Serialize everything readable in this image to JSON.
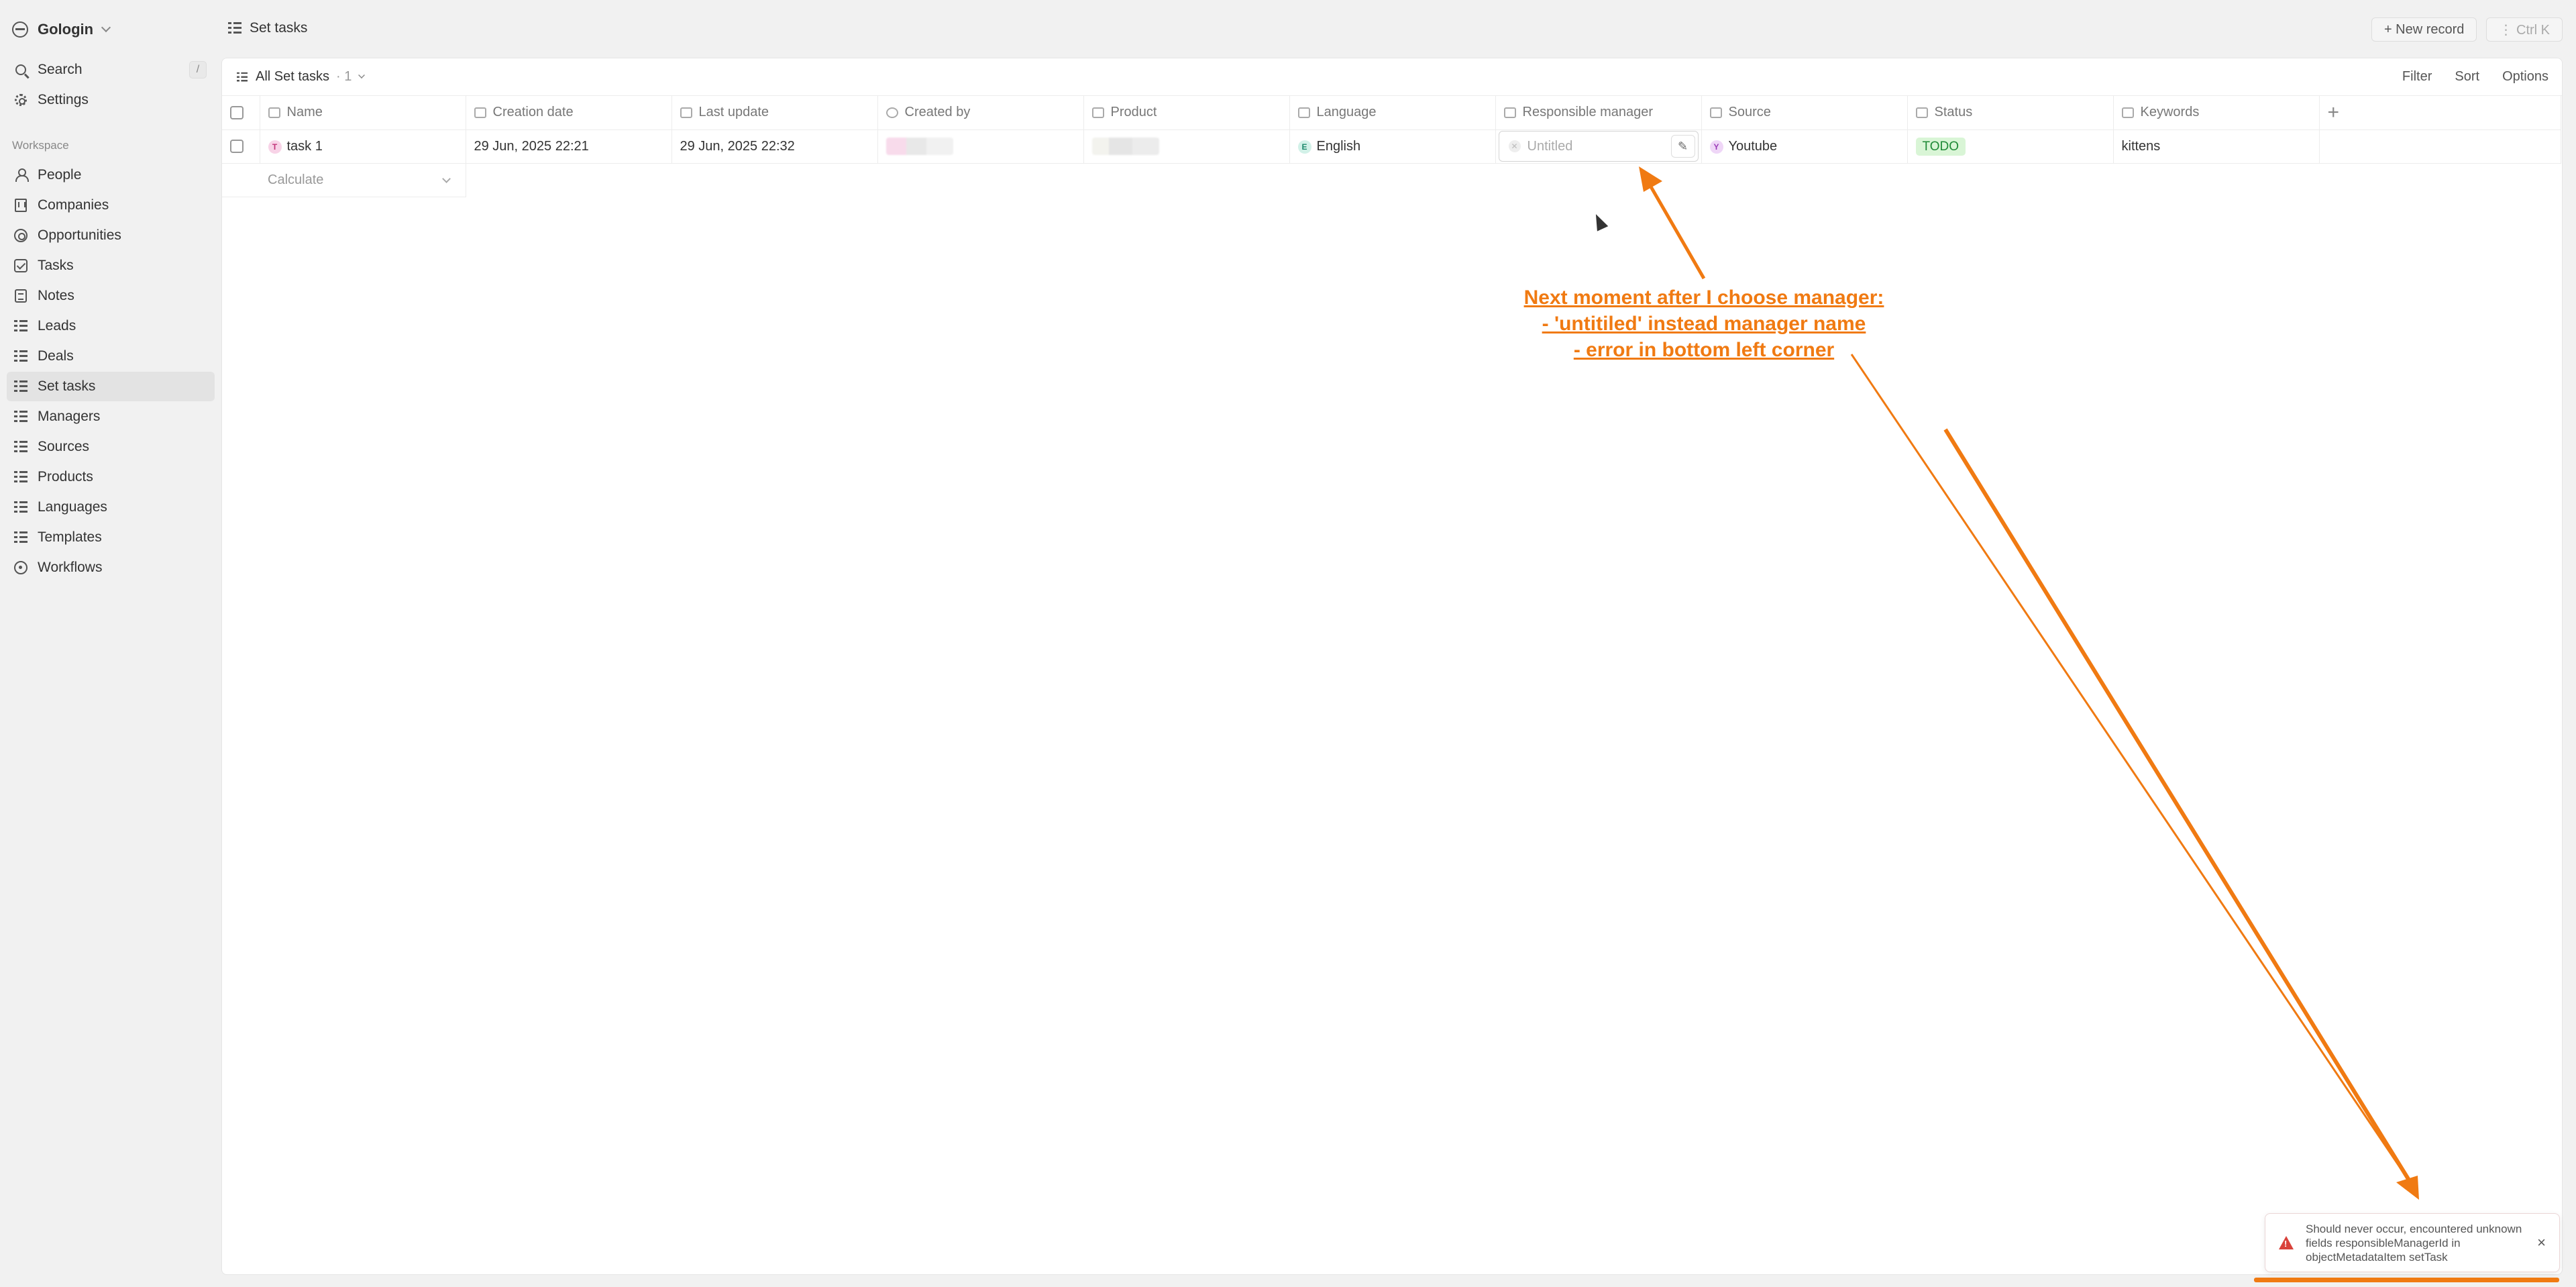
{
  "workspace": {
    "name": "Gologin"
  },
  "nav_top": [
    {
      "label": "Search",
      "icon": "search-icon",
      "shortcut": "/"
    },
    {
      "label": "Settings",
      "icon": "gear-icon"
    }
  ],
  "workspace_section": {
    "label": "Workspace",
    "items": [
      {
        "label": "People",
        "icon": "person-icon"
      },
      {
        "label": "Companies",
        "icon": "building-icon"
      },
      {
        "label": "Opportunities",
        "icon": "target-icon"
      },
      {
        "label": "Tasks",
        "icon": "checkbox-icon"
      },
      {
        "label": "Notes",
        "icon": "note-icon"
      },
      {
        "label": "Leads",
        "icon": "list-icon"
      },
      {
        "label": "Deals",
        "icon": "list-icon"
      },
      {
        "label": "Set tasks",
        "icon": "list-icon",
        "active": true
      },
      {
        "label": "Managers",
        "icon": "list-icon"
      },
      {
        "label": "Sources",
        "icon": "list-icon"
      },
      {
        "label": "Products",
        "icon": "list-icon"
      },
      {
        "label": "Languages",
        "icon": "list-icon"
      },
      {
        "label": "Templates",
        "icon": "list-icon"
      },
      {
        "label": "Workflows",
        "icon": "workflow-icon"
      }
    ]
  },
  "header": {
    "title": "Set tasks",
    "new_record": "+ New record",
    "command": "⋮ Ctrl K"
  },
  "view": {
    "name": "All Set tasks",
    "count": "· 1",
    "filter": "Filter",
    "sort": "Sort",
    "options": "Options"
  },
  "table": {
    "columns": [
      "Name",
      "Creation date",
      "Last update",
      "Created by",
      "Product",
      "Language",
      "Responsible manager",
      "Source",
      "Status",
      "Keywords"
    ],
    "row": {
      "name": "task 1",
      "name_initial": "T",
      "creation_date": "29 Jun, 2025 22:21",
      "last_update": "29 Jun, 2025 22:32",
      "language": "English",
      "language_initial": "E",
      "responsible_manager": "Untitled",
      "source": "Youtube",
      "source_initial": "Y",
      "status": "TODO",
      "keywords": "kittens"
    },
    "calculate": "Calculate"
  },
  "annotation": {
    "line1": "Next moment after I choose manager:",
    "line2": "- 'untitiled' instead manager name",
    "line3": "- error in bottom left corner"
  },
  "toast": {
    "message": "Should never occur, encountered unknown fields responsibleManagerId in objectMetadataItem setTask",
    "close": "×"
  },
  "colors": {
    "annotation": "#f07a12",
    "error": "#d9423b",
    "status_bg": "#d9f5d6"
  }
}
